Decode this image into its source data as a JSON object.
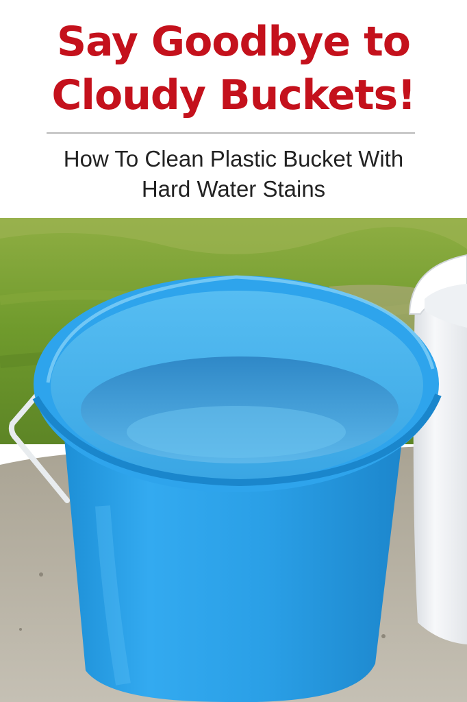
{
  "headline": {
    "line1": "Say Goodbye to",
    "line2": "Cloudy Buckets!"
  },
  "subtitle": {
    "line1": "How To Clean Plastic Bucket With",
    "line2": "Hard Water Stains"
  },
  "colors": {
    "headline": "#c4111c",
    "subtitle": "#222222",
    "bucket_blue": "#2aa3e6",
    "bucket_white": "#f4f6f8",
    "grass": "#6f9a2c",
    "sand": "#b9b4a8"
  },
  "photo": {
    "icons": [
      "blue-bucket-icon",
      "white-bucket-icon",
      "bucket-handle-icon"
    ]
  }
}
